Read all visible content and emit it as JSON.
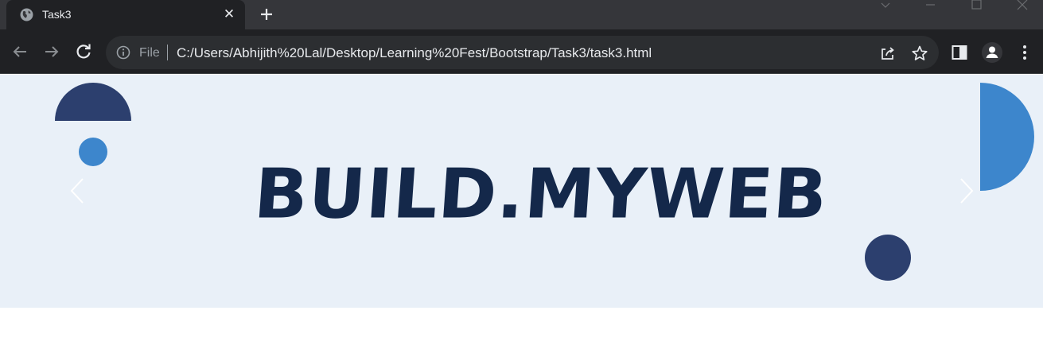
{
  "browser": {
    "tab": {
      "title": "Task3"
    },
    "address": {
      "scheme_label": "File",
      "url": "C:/Users/Abhijith%20Lal/Desktop/Learning%20Fest/Bootstrap/Task3/task3.html"
    },
    "icons": {
      "favicon": "globe-icon",
      "tab_close": "close-icon",
      "new_tab": "plus-icon",
      "back": "arrow-left-icon",
      "forward": "arrow-right-icon",
      "reload": "reload-icon",
      "site_info": "info-icon",
      "share": "share-icon",
      "bookmark": "star-icon",
      "side_panel": "side-panel-icon",
      "profile": "profile-icon",
      "menu": "kebab-menu-icon"
    }
  },
  "page": {
    "hero": {
      "brand_text": "BUILD.MYWEB",
      "colors": {
        "background": "#e9f0f8",
        "brand_text": "#14284a",
        "navy_shape": "#2c3f6e",
        "blue_shape": "#3d86cc"
      },
      "controls": {
        "prev": "chevron-left-icon",
        "next": "chevron-right-icon"
      }
    }
  }
}
